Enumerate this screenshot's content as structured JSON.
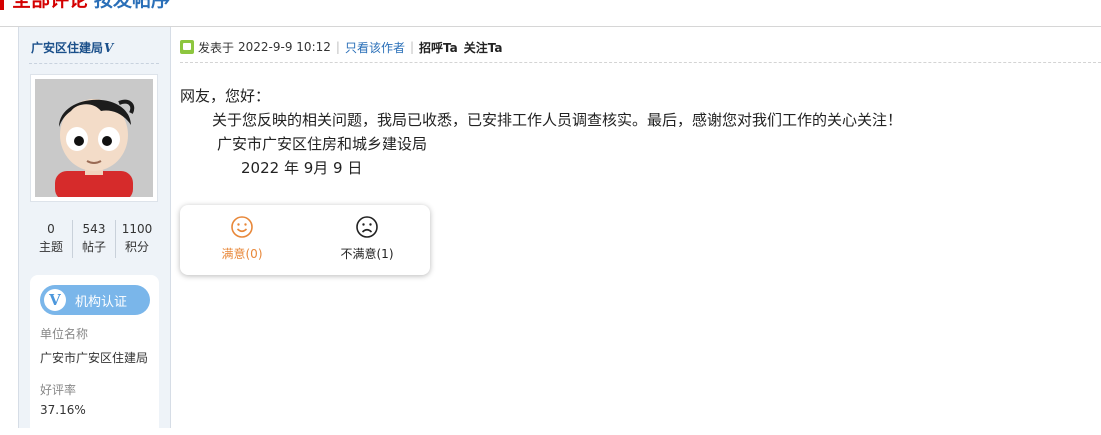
{
  "page": {
    "heading_1": "全部评论",
    "heading_2": "按发帖序"
  },
  "author": {
    "name": "广安区住建局",
    "verified_mark": "V",
    "stats": [
      {
        "value": "0",
        "label": "主题"
      },
      {
        "value": "543",
        "label": "帖子"
      },
      {
        "value": "1100",
        "label": "积分"
      }
    ],
    "cert": {
      "badge_label": "机构认证",
      "unit_label": "单位名称",
      "unit_value": "广安市广安区住建局",
      "rating_label": "好评率",
      "rating_value": "37.16%"
    }
  },
  "post": {
    "posted_prefix": "发表于",
    "timestamp": "2022-9-9 10:12",
    "only_author": "只看该作者",
    "greet_button": "招呼Ta",
    "follow_button": "关注Ta",
    "body_lines": [
      "网友，您好：",
      "        关于您反映的相关问题，我局已收悉，已安排工作人员调查核实。最后，感谢您对我们工作的关心关注！",
      "         广安市广安区住房和城乡建设局",
      "              2022 年 9月 9 日"
    ]
  },
  "rating": {
    "satisfied": "满意(0)",
    "unsatisfied": "不满意(1)"
  },
  "colors": {
    "heading_red": "#d40000",
    "link_blue": "#2a6fb8",
    "satisfied_orange": "#e8883a",
    "badge_blue": "#7ab6ea"
  },
  "icons": [
    "post-icon",
    "satisfied-face-icon",
    "unsatisfied-face-icon",
    "verified-v-icon"
  ]
}
